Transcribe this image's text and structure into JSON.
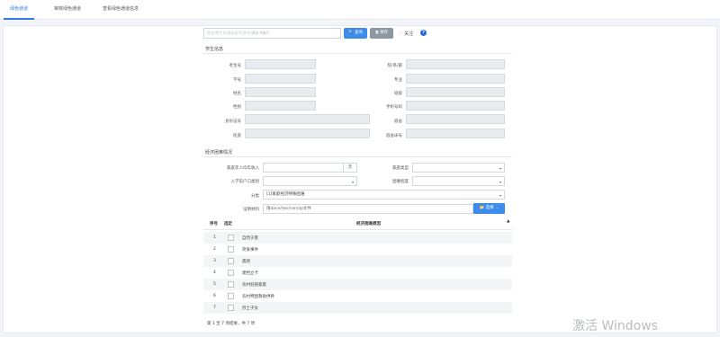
{
  "tabs": [
    {
      "label": "绿色通道",
      "active": true
    },
    {
      "label": "审核绿色通道",
      "active": false
    },
    {
      "label": "查看绿色通道信息",
      "active": false
    }
  ],
  "search": {
    "placeholder": "姓名/考生号/身份证号/学号/通知书编号",
    "search_label": "🔍 查询",
    "save_label": "🖫 保存",
    "follow_label": "关注",
    "help_label": "?"
  },
  "student": {
    "section_title": "学生信息",
    "fields": {
      "exam_no": "考生号",
      "dept": "院/系/部",
      "student_no": "学号",
      "major": "专业",
      "name": "姓名",
      "class": "班级",
      "gender": "性别",
      "phone": "手机号码",
      "id_card": "身份证号",
      "dorm": "宿舍",
      "nation": "民族",
      "dorm_bed": "宿舍床号"
    }
  },
  "economy": {
    "section_title": "经济困难情况",
    "income_label": "家庭年人均年收入",
    "income_unit": "元",
    "family_type_label": "家庭类型",
    "hukou_label": "入学前户口类别",
    "difficulty_label": "困难程度",
    "category_label": "分类",
    "category_value": "[1]家庭经济特殊困难",
    "proof_label": "证明材料",
    "proof_placeholder": "限docx/doc/rar/zip文件",
    "choose_label": "📂 选择 ..."
  },
  "table": {
    "headers": {
      "index": "序号",
      "select": "选定",
      "reason": "经济困难原因"
    },
    "rows": [
      {
        "index": "1",
        "reason": "自然灾害"
      },
      {
        "index": "2",
        "reason": "突发事件"
      },
      {
        "index": "3",
        "reason": "孤残"
      },
      {
        "index": "4",
        "reason": "建档立卡"
      },
      {
        "index": "5",
        "reason": "农村低保家庭"
      },
      {
        "index": "6",
        "reason": "农村特困救助供养"
      },
      {
        "index": "7",
        "reason": "烈士子女"
      }
    ],
    "footer": "第 1 至 7 项结果，共 7 项"
  },
  "watermark": "激活 Windows"
}
